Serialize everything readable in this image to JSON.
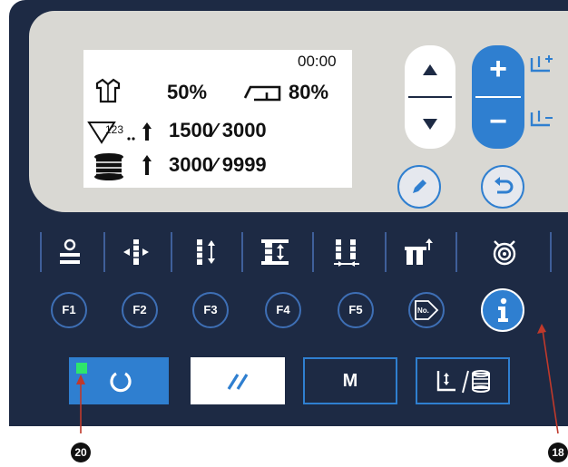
{
  "display": {
    "time": "00:00",
    "speed_percent": "50%",
    "presser_percent": "80%",
    "production_counter": "1500∕ 3000",
    "bobbin_counter": "3000∕ 9999"
  },
  "keys": {
    "plus": "+",
    "minus": "−",
    "m_label": "M"
  },
  "function_keys": [
    "F1",
    "F2",
    "F3",
    "F4",
    "F5"
  ],
  "callouts": {
    "left": "20",
    "right": "18"
  },
  "colors": {
    "panel": "#1d2a44",
    "accent_blue": "#2f7fd0",
    "status_led": "#2ee66b"
  }
}
